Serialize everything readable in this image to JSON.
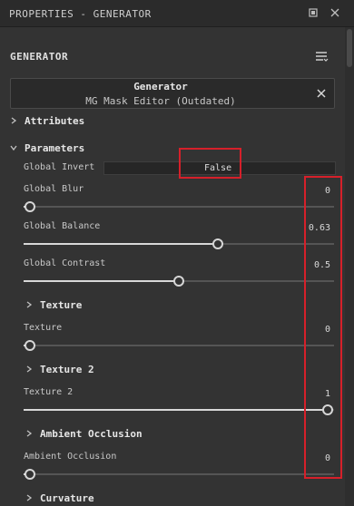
{
  "window": {
    "title": "PROPERTIES - GENERATOR"
  },
  "panel": {
    "header": "GENERATOR",
    "node_title": "Generator",
    "node_subtitle": "MG Mask Editor (Outdated)"
  },
  "groups": {
    "attributes": "Attributes",
    "parameters": "Parameters",
    "texture": "Texture",
    "texture2": "Texture 2",
    "ambient": "Ambient Occlusion",
    "curvature": "Curvature"
  },
  "params": {
    "global_invert": {
      "label": "Global Invert",
      "value": "False"
    },
    "global_blur": {
      "label": "Global Blur",
      "value": "0",
      "fraction": 0
    },
    "global_balance": {
      "label": "Global Balance",
      "value": "0.63",
      "fraction": 0.63
    },
    "global_contrast": {
      "label": "Global Contrast",
      "value": "0.5",
      "fraction": 0.5
    },
    "texture": {
      "label": "Texture",
      "value": "0",
      "fraction": 0
    },
    "texture2": {
      "label": "Texture 2",
      "value": "1",
      "fraction": 1
    },
    "ambient": {
      "label": "Ambient Occlusion",
      "value": "0",
      "fraction": 0
    }
  },
  "icons": {
    "window_restore": "restore-icon",
    "window_close": "close-icon",
    "menu": "hamburger-menu-icon",
    "chevron_right": "chevron-right-icon",
    "chevron_down": "chevron-down-icon"
  },
  "colors": {
    "highlight": "#d6202a",
    "background": "#333333"
  }
}
